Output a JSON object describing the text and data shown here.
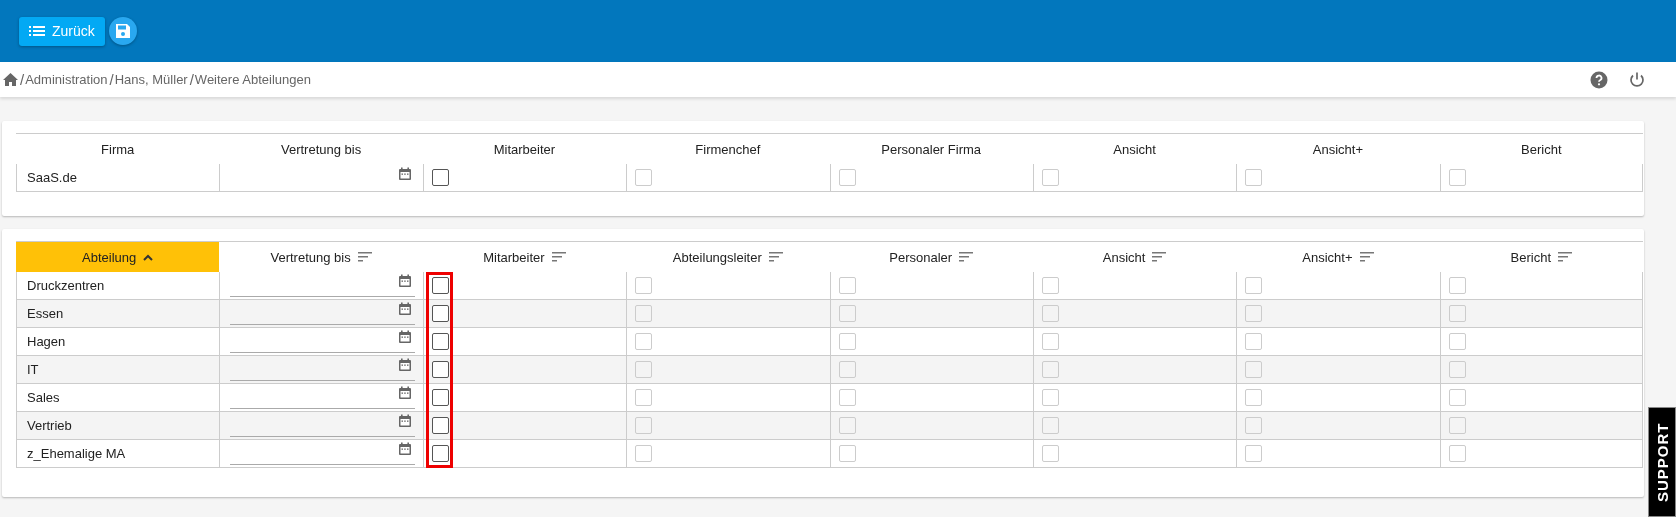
{
  "header": {
    "back_button": "Zurück"
  },
  "breadcrumb": [
    {
      "separator": "/",
      "label": "Administration"
    },
    {
      "separator": "/",
      "label": "Hans, Müller"
    },
    {
      "separator": "/",
      "label": "Weitere Abteilungen"
    }
  ],
  "company_table": {
    "columns": [
      "Firma",
      "Vertretung bis",
      "Mitarbeiter",
      "Firmenchef",
      "Personaler Firma",
      "Ansicht",
      "Ansicht+",
      "Bericht"
    ],
    "rows": [
      {
        "name": "SaaS.de",
        "checks": [
          {
            "checked": false,
            "disabled": false
          },
          {
            "checked": false,
            "disabled": true
          },
          {
            "checked": false,
            "disabled": true
          },
          {
            "checked": false,
            "disabled": true
          },
          {
            "checked": false,
            "disabled": true
          },
          {
            "checked": false,
            "disabled": true
          }
        ]
      }
    ]
  },
  "department_table": {
    "columns": [
      {
        "label": "Abteilung",
        "selected": true,
        "highlight": false
      },
      {
        "label": "Vertretung bis",
        "selected": false,
        "highlight": false
      },
      {
        "label": "Mitarbeiter",
        "selected": false,
        "highlight": true
      },
      {
        "label": "Abteilungsleiter",
        "selected": false,
        "highlight": false
      },
      {
        "label": "Personaler",
        "selected": false,
        "highlight": false
      },
      {
        "label": "Ansicht",
        "selected": false,
        "highlight": false
      },
      {
        "label": "Ansicht+",
        "selected": false,
        "highlight": false
      },
      {
        "label": "Bericht",
        "selected": false,
        "highlight": false
      }
    ],
    "rows": [
      {
        "name": "Druckzentren",
        "checks": [
          {
            "checked": false,
            "disabled": false
          },
          {
            "checked": false,
            "disabled": true
          },
          {
            "checked": false,
            "disabled": true
          },
          {
            "checked": false,
            "disabled": true
          },
          {
            "checked": false,
            "disabled": true
          },
          {
            "checked": false,
            "disabled": true
          }
        ]
      },
      {
        "name": "Essen",
        "checks": [
          {
            "checked": false,
            "disabled": false
          },
          {
            "checked": false,
            "disabled": true
          },
          {
            "checked": false,
            "disabled": true
          },
          {
            "checked": false,
            "disabled": true
          },
          {
            "checked": false,
            "disabled": true
          },
          {
            "checked": false,
            "disabled": true
          }
        ]
      },
      {
        "name": "Hagen",
        "checks": [
          {
            "checked": false,
            "disabled": false
          },
          {
            "checked": false,
            "disabled": true
          },
          {
            "checked": false,
            "disabled": true
          },
          {
            "checked": false,
            "disabled": true
          },
          {
            "checked": false,
            "disabled": true
          },
          {
            "checked": false,
            "disabled": true
          }
        ]
      },
      {
        "name": "IT",
        "checks": [
          {
            "checked": false,
            "disabled": false
          },
          {
            "checked": false,
            "disabled": true
          },
          {
            "checked": false,
            "disabled": true
          },
          {
            "checked": false,
            "disabled": true
          },
          {
            "checked": false,
            "disabled": true
          },
          {
            "checked": false,
            "disabled": true
          }
        ]
      },
      {
        "name": "Sales",
        "checks": [
          {
            "checked": false,
            "disabled": false
          },
          {
            "checked": false,
            "disabled": true
          },
          {
            "checked": false,
            "disabled": true
          },
          {
            "checked": false,
            "disabled": true
          },
          {
            "checked": false,
            "disabled": true
          },
          {
            "checked": false,
            "disabled": true
          }
        ]
      },
      {
        "name": "Vertrieb",
        "checks": [
          {
            "checked": false,
            "disabled": false
          },
          {
            "checked": false,
            "disabled": true
          },
          {
            "checked": false,
            "disabled": true
          },
          {
            "checked": false,
            "disabled": true
          },
          {
            "checked": false,
            "disabled": true
          },
          {
            "checked": false,
            "disabled": true
          }
        ]
      },
      {
        "name": "z_Ehemalige MA",
        "checks": [
          {
            "checked": false,
            "disabled": false
          },
          {
            "checked": false,
            "disabled": true
          },
          {
            "checked": false,
            "disabled": true
          },
          {
            "checked": false,
            "disabled": true
          },
          {
            "checked": false,
            "disabled": true
          },
          {
            "checked": false,
            "disabled": true
          }
        ]
      }
    ]
  },
  "support_tab": "SUPPORT"
}
